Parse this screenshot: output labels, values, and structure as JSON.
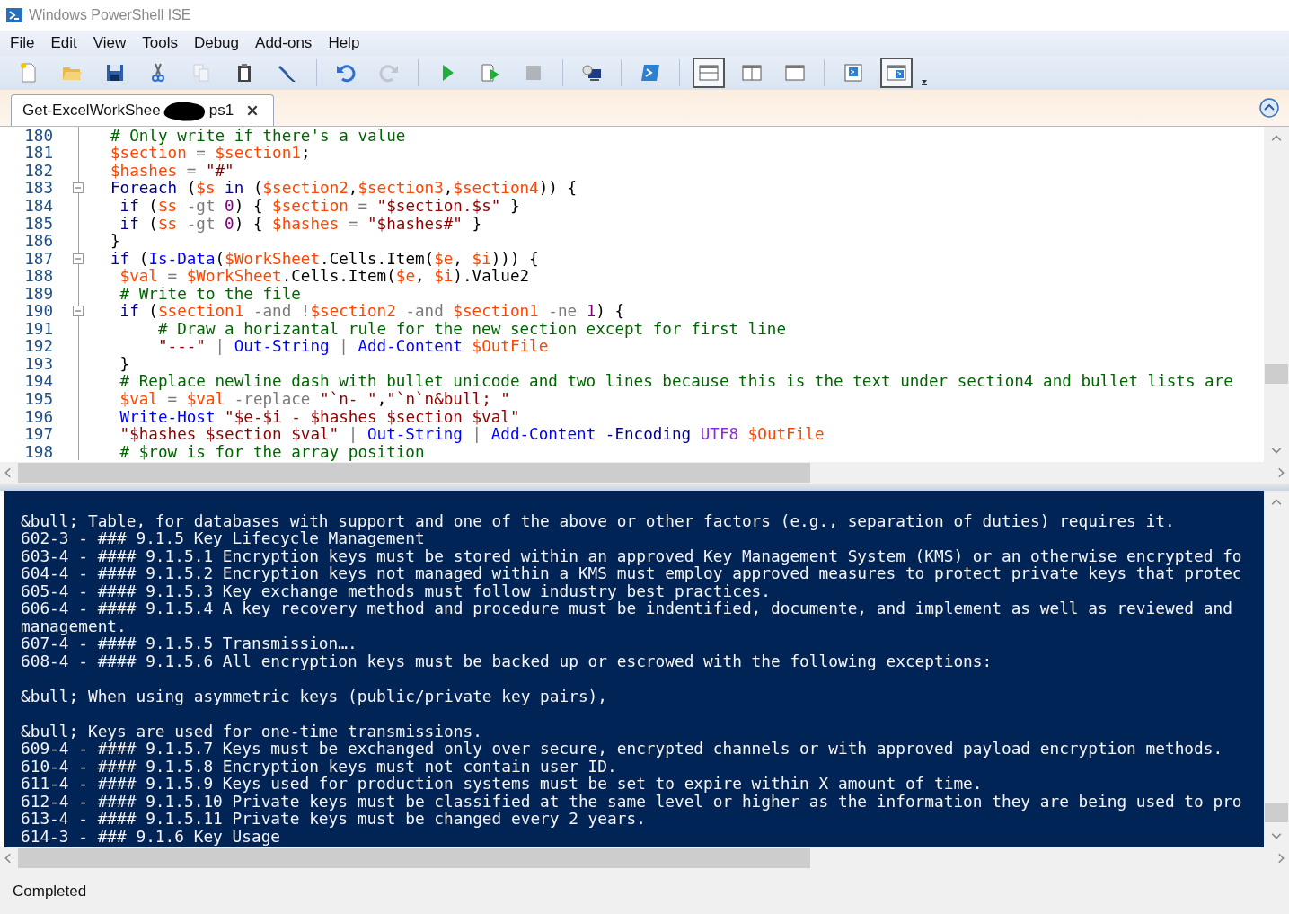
{
  "window": {
    "title": "Windows PowerShell ISE"
  },
  "menu": [
    "File",
    "Edit",
    "View",
    "Tools",
    "Debug",
    "Add-ons",
    "Help"
  ],
  "toolbar": [
    {
      "kind": "new",
      "disabled": false
    },
    {
      "kind": "open",
      "disabled": false
    },
    {
      "kind": "save",
      "disabled": false
    },
    {
      "kind": "cut",
      "disabled": false
    },
    {
      "kind": "copy",
      "disabled": true
    },
    {
      "kind": "paste",
      "disabled": false
    },
    {
      "kind": "clear",
      "disabled": false
    },
    {
      "kind": "separator"
    },
    {
      "kind": "undo",
      "disabled": false
    },
    {
      "kind": "redo",
      "disabled": true
    },
    {
      "kind": "separator"
    },
    {
      "kind": "run",
      "disabled": false
    },
    {
      "kind": "run-selection",
      "disabled": false
    },
    {
      "kind": "stop",
      "disabled": true
    },
    {
      "kind": "separator"
    },
    {
      "kind": "remote",
      "disabled": false
    },
    {
      "kind": "separator"
    },
    {
      "kind": "powershell",
      "disabled": false
    },
    {
      "kind": "separator"
    },
    {
      "kind": "layout-top",
      "selected": true
    },
    {
      "kind": "layout-right",
      "selected": false
    },
    {
      "kind": "layout-max",
      "selected": false
    },
    {
      "kind": "separator"
    },
    {
      "kind": "show-script",
      "selected": false
    },
    {
      "kind": "show-console",
      "selected": true
    }
  ],
  "tab": {
    "label_start": "Get-ExcelWorkShee",
    "label_end": "ps1",
    "selected": true
  },
  "editor": {
    "lines": [
      {
        "number": "180",
        "tokens": [
          {
            "kind": "comment",
            "text": "# Only write if there's a value"
          }
        ]
      },
      {
        "number": "181",
        "tokens": [
          {
            "kind": "variable",
            "text": "$section"
          },
          {
            "kind": "operator",
            "text": " ="
          },
          {
            "kind": "variable",
            "text": " $section1"
          },
          {
            "kind": "plain",
            "text": ";"
          }
        ]
      },
      {
        "number": "182",
        "tokens": [
          {
            "kind": "variable",
            "text": "$hashes"
          },
          {
            "kind": "operator",
            "text": " ="
          },
          {
            "kind": "string",
            "text": " \"#\""
          }
        ]
      },
      {
        "number": "183",
        "fold_expanded": true,
        "tokens": [
          {
            "kind": "keyword",
            "text": "Foreach"
          },
          {
            "kind": "plain",
            "text": " ("
          },
          {
            "kind": "variable",
            "text": "$s"
          },
          {
            "kind": "keyword",
            "text": " in"
          },
          {
            "kind": "plain",
            "text": " ("
          },
          {
            "kind": "variable",
            "text": "$section2"
          },
          {
            "kind": "plain",
            "text": ","
          },
          {
            "kind": "variable",
            "text": "$section3"
          },
          {
            "kind": "plain",
            "text": ","
          },
          {
            "kind": "variable",
            "text": "$section4"
          },
          {
            "kind": "plain",
            "text": ")) {"
          }
        ]
      },
      {
        "number": "184",
        "tokens": [
          {
            "kind": "keyword",
            "text": " if"
          },
          {
            "kind": "plain",
            "text": " ("
          },
          {
            "kind": "variable",
            "text": "$s"
          },
          {
            "kind": "operator",
            "text": " -gt"
          },
          {
            "kind": "number",
            "text": " 0"
          },
          {
            "kind": "plain",
            "text": ") {"
          },
          {
            "kind": "variable",
            "text": " $section"
          },
          {
            "kind": "operator",
            "text": " ="
          },
          {
            "kind": "string",
            "text": " \"$section.$s\""
          },
          {
            "kind": "plain",
            "text": " }"
          }
        ]
      },
      {
        "number": "185",
        "tokens": [
          {
            "kind": "keyword",
            "text": " if"
          },
          {
            "kind": "plain",
            "text": " ("
          },
          {
            "kind": "variable",
            "text": "$s"
          },
          {
            "kind": "operator",
            "text": " -gt"
          },
          {
            "kind": "number",
            "text": " 0"
          },
          {
            "kind": "plain",
            "text": ") {"
          },
          {
            "kind": "variable",
            "text": " $hashes"
          },
          {
            "kind": "operator",
            "text": " ="
          },
          {
            "kind": "string",
            "text": " \"$hashes#\""
          },
          {
            "kind": "plain",
            "text": " }"
          }
        ]
      },
      {
        "number": "186",
        "tokens": [
          {
            "kind": "plain",
            "text": "}"
          }
        ]
      },
      {
        "number": "187",
        "fold_expanded": true,
        "tokens": [
          {
            "kind": "keyword",
            "text": "if"
          },
          {
            "kind": "plain",
            "text": " ("
          },
          {
            "kind": "command",
            "text": "Is-Data"
          },
          {
            "kind": "plain",
            "text": "("
          },
          {
            "kind": "variable",
            "text": "$WorkSheet"
          },
          {
            "kind": "plain",
            "text": ".Cells.Item("
          },
          {
            "kind": "variable",
            "text": "$e"
          },
          {
            "kind": "plain",
            "text": ","
          },
          {
            "kind": "variable",
            "text": " $i"
          },
          {
            "kind": "plain",
            "text": "))) {"
          }
        ]
      },
      {
        "number": "188",
        "tokens": [
          {
            "kind": "variable",
            "text": " $val"
          },
          {
            "kind": "operator",
            "text": " ="
          },
          {
            "kind": "variable",
            "text": " $WorkSheet"
          },
          {
            "kind": "plain",
            "text": ".Cells.Item("
          },
          {
            "kind": "variable",
            "text": "$e"
          },
          {
            "kind": "plain",
            "text": ","
          },
          {
            "kind": "variable",
            "text": " $i"
          },
          {
            "kind": "plain",
            "text": ").Value2"
          }
        ]
      },
      {
        "number": "189",
        "tokens": [
          {
            "kind": "comment",
            "text": " # Write to the file"
          }
        ]
      },
      {
        "number": "190",
        "fold_expanded": true,
        "tokens": [
          {
            "kind": "keyword",
            "text": " if"
          },
          {
            "kind": "plain",
            "text": " ("
          },
          {
            "kind": "variable",
            "text": "$section1"
          },
          {
            "kind": "operator",
            "text": " -and"
          },
          {
            "kind": "operator",
            "text": " !"
          },
          {
            "kind": "variable",
            "text": "$section2"
          },
          {
            "kind": "operator",
            "text": " -and"
          },
          {
            "kind": "variable",
            "text": " $section1"
          },
          {
            "kind": "operator",
            "text": " -ne"
          },
          {
            "kind": "number",
            "text": " 1"
          },
          {
            "kind": "plain",
            "text": ") {"
          }
        ]
      },
      {
        "number": "191",
        "tokens": [
          {
            "kind": "comment",
            "text": "     # Draw a horizantal rule for the new section except for first line"
          }
        ]
      },
      {
        "number": "192",
        "tokens": [
          {
            "kind": "string",
            "text": "     \"---\""
          },
          {
            "kind": "operator",
            "text": " |"
          },
          {
            "kind": "command",
            "text": " Out-String"
          },
          {
            "kind": "operator",
            "text": " |"
          },
          {
            "kind": "command",
            "text": " Add-Content"
          },
          {
            "kind": "variable",
            "text": " $OutFile"
          }
        ]
      },
      {
        "number": "193",
        "tokens": [
          {
            "kind": "plain",
            "text": " }"
          }
        ]
      },
      {
        "number": "194",
        "tokens": [
          {
            "kind": "comment",
            "text": " # Replace newline dash with bullet unicode and two lines because this is the text under section4 and bullet lists are"
          }
        ]
      },
      {
        "number": "195",
        "tokens": [
          {
            "kind": "variable",
            "text": " $val"
          },
          {
            "kind": "operator",
            "text": " ="
          },
          {
            "kind": "variable",
            "text": " $val"
          },
          {
            "kind": "operator",
            "text": " -replace"
          },
          {
            "kind": "string",
            "text": " \"`n- \""
          },
          {
            "kind": "plain",
            "text": ","
          },
          {
            "kind": "string",
            "text": "\"`n`n&bull; \""
          }
        ]
      },
      {
        "number": "196",
        "tokens": [
          {
            "kind": "command",
            "text": " Write-Host"
          },
          {
            "kind": "string",
            "text": " \"$e-$i - $hashes $section $val\""
          }
        ]
      },
      {
        "number": "197",
        "tokens": [
          {
            "kind": "string",
            "text": " \"$hashes $section $val\""
          },
          {
            "kind": "operator",
            "text": " |"
          },
          {
            "kind": "command",
            "text": " Out-String"
          },
          {
            "kind": "operator",
            "text": " |"
          },
          {
            "kind": "command",
            "text": " Add-Content"
          },
          {
            "kind": "parameter",
            "text": " -Encoding"
          },
          {
            "kind": "argument",
            "text": " UTF8"
          },
          {
            "kind": "variable",
            "text": " $OutFile"
          }
        ]
      },
      {
        "number": "198",
        "tokens": [
          {
            "kind": "comment",
            "text": " # $row is for the array position"
          }
        ]
      }
    ]
  },
  "console": {
    "lines": [
      {
        "kind": "blank"
      },
      {
        "kind": "text",
        "text": "&bull; Table, for databases with support and one of the above or other factors (e.g., separation of duties) requires it."
      },
      {
        "kind": "text",
        "text": "602-3 - ### 9.1.5 Key Lifecycle Management"
      },
      {
        "kind": "text",
        "text": "603-4 - #### 9.1.5.1 Encryption keys must be stored within an approved Key Management System (KMS) or an otherwise encrypted fo"
      },
      {
        "kind": "text",
        "text": "604-4 - #### 9.1.5.2 Encryption keys not managed within a KMS must employ approved measures to protect private keys that protec"
      },
      {
        "kind": "text",
        "text": "605-4 - #### 9.1.5.3 Key exchange methods must follow industry best practices."
      },
      {
        "kind": "text",
        "text": "606-4 - #### 9.1.5.4 A key recovery method and procedure must be indentified, documente, and implement as well as reviewed and"
      },
      {
        "kind": "text",
        "text": "management."
      },
      {
        "kind": "text",
        "text": "607-4 - #### 9.1.5.5 Transmission…."
      },
      {
        "kind": "text",
        "text": "608-4 - #### 9.1.5.6 All encryption keys must be backed up or escrowed with the following exceptions:"
      },
      {
        "kind": "blank"
      },
      {
        "kind": "text",
        "text": "&bull; When using asymmetric keys (public/private key pairs),"
      },
      {
        "kind": "blank"
      },
      {
        "kind": "text",
        "text": "&bull; Keys are used for one-time transmissions."
      },
      {
        "kind": "text",
        "text": "609-4 - #### 9.1.5.7 Keys must be exchanged only over secure, encrypted channels or with approved payload encryption methods."
      },
      {
        "kind": "text",
        "text": "610-4 - #### 9.1.5.8 Encryption keys must not contain user ID."
      },
      {
        "kind": "text",
        "text": "611-4 - #### 9.1.5.9 Keys used for production systems must be set to expire within X amount of time."
      },
      {
        "kind": "text",
        "text": "612-4 - #### 9.1.5.10 Private keys must be classified at the same level or higher as the information they are being used to pro"
      },
      {
        "kind": "text",
        "text": "613-4 - #### 9.1.5.11 Private keys must be changed every 2 years."
      },
      {
        "kind": "text",
        "text": "614-3 - ### 9.1.6 Key Usage"
      }
    ]
  },
  "status_bar": {
    "text": "Completed"
  }
}
